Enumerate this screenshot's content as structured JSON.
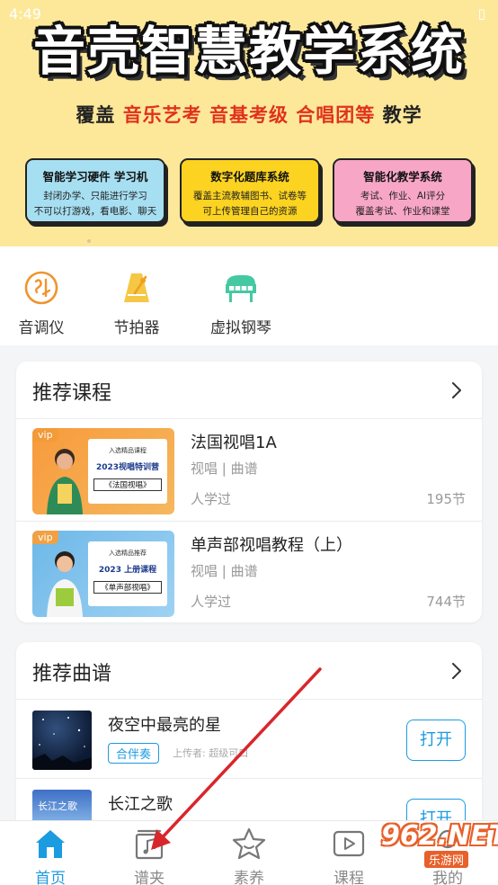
{
  "status": {
    "time": "4:49",
    "battery": "▯"
  },
  "banner": {
    "title": "音壳智慧教学系统",
    "subtitle_prefix": "覆盖",
    "subtitle_items": "音乐艺考 音基考级 合唱团等",
    "subtitle_suffix": "教学",
    "features": [
      {
        "title": "智能学习硬件 学习机",
        "lines": [
          "封闭办学、只能进行学习",
          "不可以打游戏，看电影、聊天"
        ]
      },
      {
        "title": "数字化题库系统",
        "lines": [
          "覆盖主流教辅图书、试卷等",
          "可上传管理自己的资源"
        ]
      },
      {
        "title": "智能化教学系统",
        "lines": [
          "考试、作业、AI评分",
          "覆盖考试、作业和课堂"
        ]
      }
    ]
  },
  "tools": [
    {
      "label": "音调仪",
      "icon": "tuner-icon"
    },
    {
      "label": "节拍器",
      "icon": "metronome-icon"
    },
    {
      "label": "虚拟钢琴",
      "icon": "piano-icon"
    }
  ],
  "courses": {
    "title": "推荐课程",
    "items": [
      {
        "title": "法国视唱1A",
        "tags": "视唱 | 曲谱",
        "learned": "人学过",
        "count": "195节",
        "vip": "vip",
        "thumb": {
          "line1": "入选精品课程",
          "line2": "2023视唱特训营",
          "line3": "《法国视唱》"
        }
      },
      {
        "title": "单声部视唱教程（上）",
        "tags": "视唱 | 曲谱",
        "learned": "人学过",
        "count": "744节",
        "vip": "vip",
        "thumb": {
          "line1": "入选精品推荐",
          "line2": "2023 上册课程",
          "line3": "《单声部视唱》"
        }
      }
    ]
  },
  "scores": {
    "title": "推荐曲谱",
    "items": [
      {
        "title": "夜空中最亮的星",
        "tag": "合伴奏",
        "uploader": "上传者: 超级可口",
        "button": "打开"
      },
      {
        "title": "长江之歌",
        "thumb_text": "长江之歌",
        "button": "打开"
      }
    ]
  },
  "tabs": [
    {
      "label": "首页",
      "icon": "home-icon",
      "active": true
    },
    {
      "label": "谱夹",
      "icon": "music-folder-icon",
      "active": false
    },
    {
      "label": "素养",
      "icon": "star-icon",
      "active": false
    },
    {
      "label": "课程",
      "icon": "video-course-icon",
      "active": false
    },
    {
      "label": "我的",
      "icon": "profile-icon",
      "active": false
    }
  ],
  "watermark": {
    "main": "962.NET",
    "sub": "乐游网"
  },
  "colors": {
    "accent": "#1b9be0",
    "banner_bg": "#fde89a",
    "highlight_red": "#e0321c",
    "annotation_arrow": "#d9262b"
  }
}
